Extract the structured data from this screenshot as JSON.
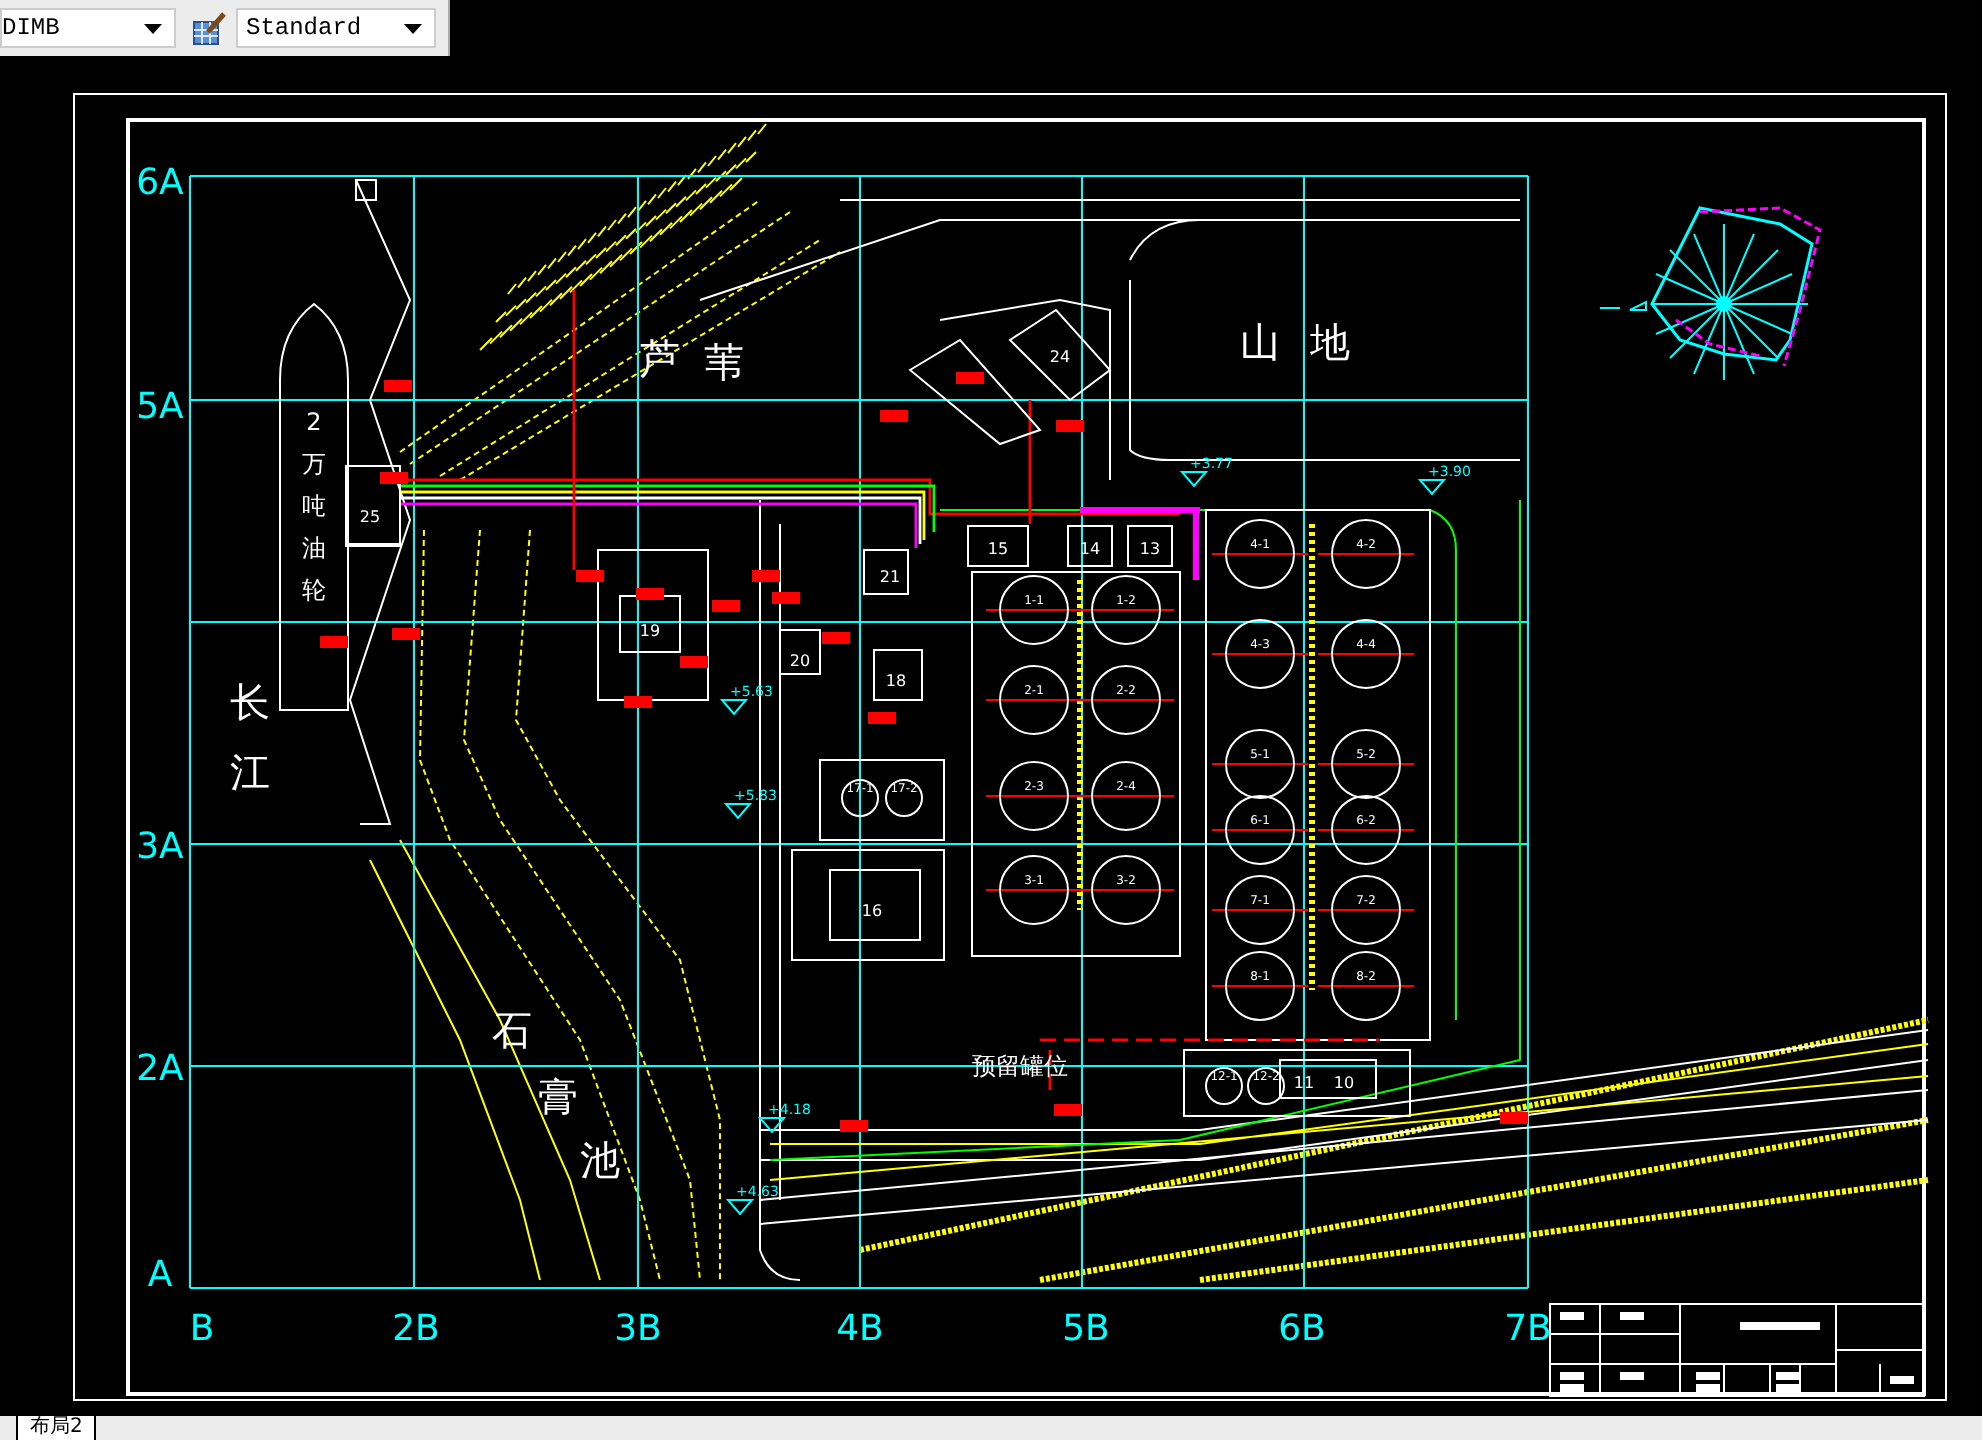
{
  "toolbar": {
    "dim_style": "DIMB",
    "text_style": "Standard"
  },
  "drawing": {
    "row_labels": [
      "6A",
      "5A",
      "3A",
      "2A",
      "A"
    ],
    "column_labels": [
      "B",
      "2B",
      "3B",
      "4B",
      "5B",
      "6B",
      "7B"
    ],
    "place_labels": [
      "芦",
      "苇",
      "山",
      "地",
      "长",
      "江",
      "石",
      "膏",
      "池"
    ],
    "ship_label": "2万吨油轮",
    "building_labels": [
      "25",
      "19",
      "20",
      "21",
      "18",
      "16",
      "15",
      "14",
      "13",
      "24",
      "11",
      "10"
    ],
    "tank_labels": [
      "1-1",
      "1-2",
      "2-1",
      "2-2",
      "2-3",
      "2-4",
      "3-1",
      "3-2",
      "4-1",
      "4-2",
      "4-3",
      "4-4",
      "5-1",
      "5-2",
      "6-1",
      "6-2",
      "7-1",
      "7-2",
      "8-1",
      "8-2",
      "12-1",
      "12-2",
      "17-1",
      "17-2"
    ],
    "elevations": [
      "+3.90",
      "+5.63",
      "+5.83",
      "+3.77",
      "+4.18",
      "+4.63"
    ],
    "reserved_area": "预留罐位"
  },
  "layout_tab": "布局2"
}
